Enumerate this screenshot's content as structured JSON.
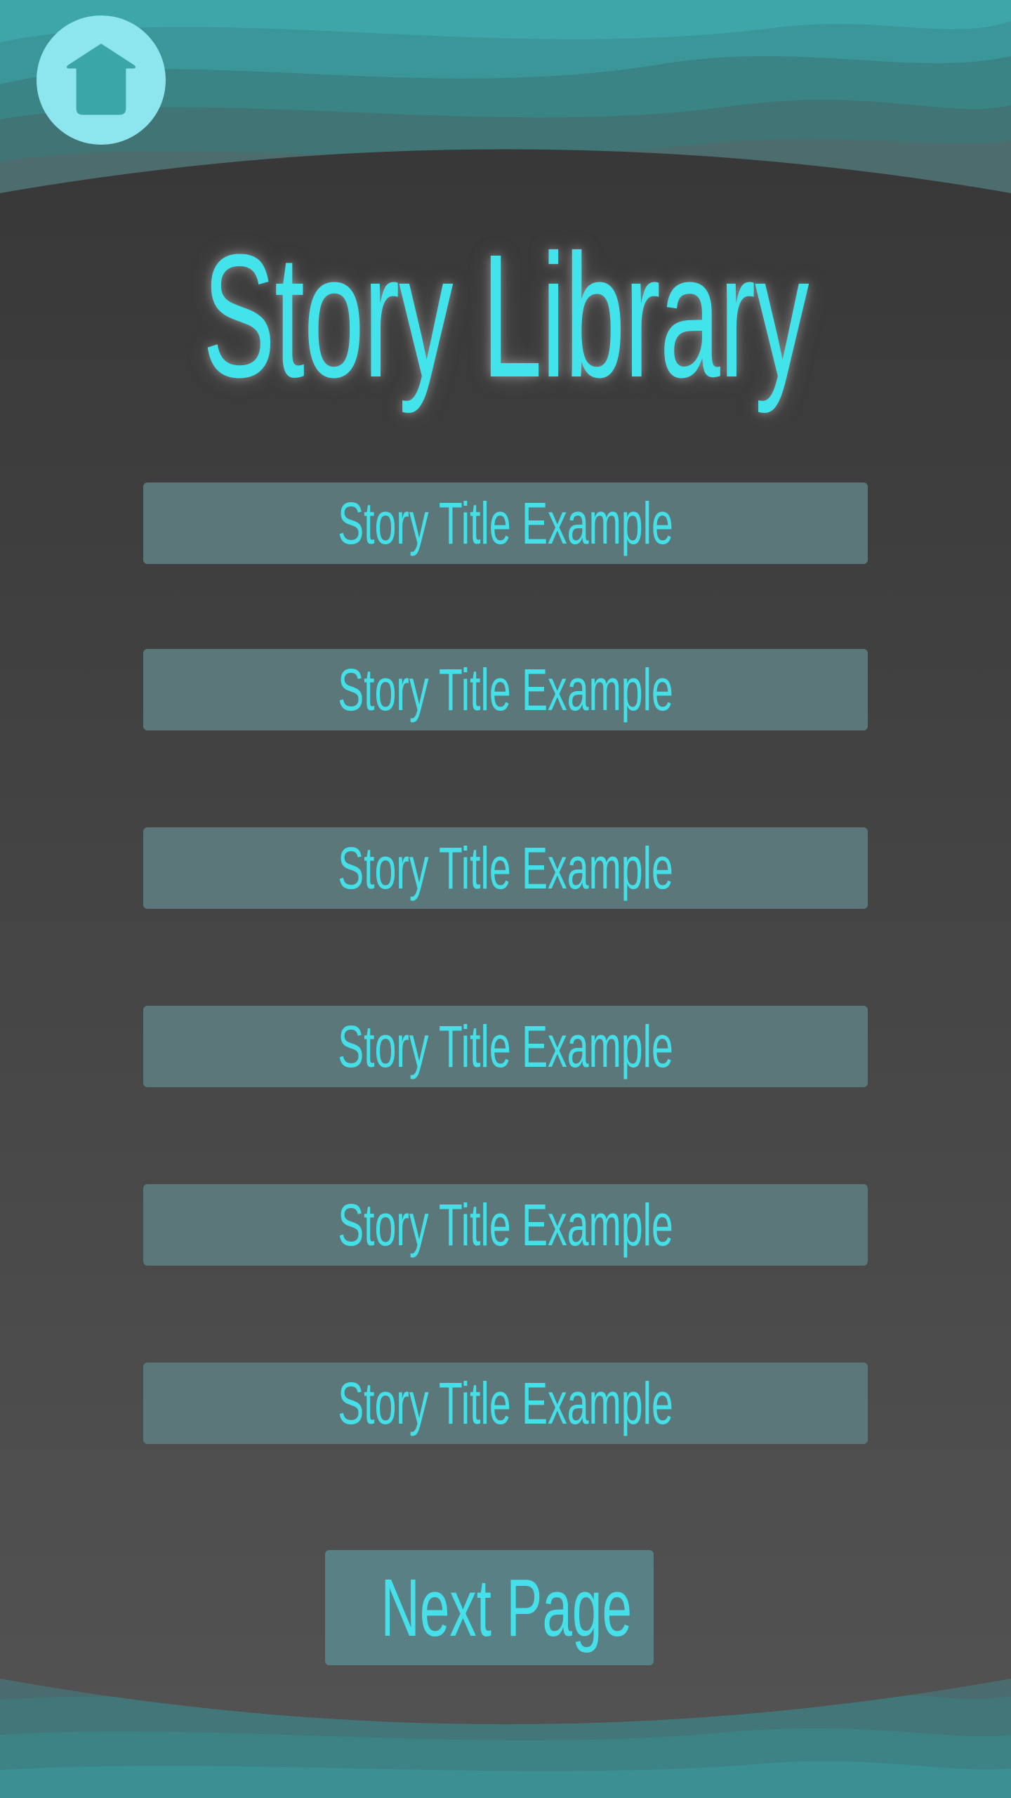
{
  "header": {
    "home_icon": "home-icon"
  },
  "title": "Story Library",
  "stories": [
    "Story Title Example",
    "Story Title Example",
    "Story Title Example",
    "Story Title Example",
    "Story Title Example",
    "Story Title Example"
  ],
  "next_page_label": "Next Page",
  "colors": {
    "accent": "#43e3ec",
    "background": "#3a3a3a",
    "button": "#5b7779",
    "wave": "#3a9a9c"
  }
}
